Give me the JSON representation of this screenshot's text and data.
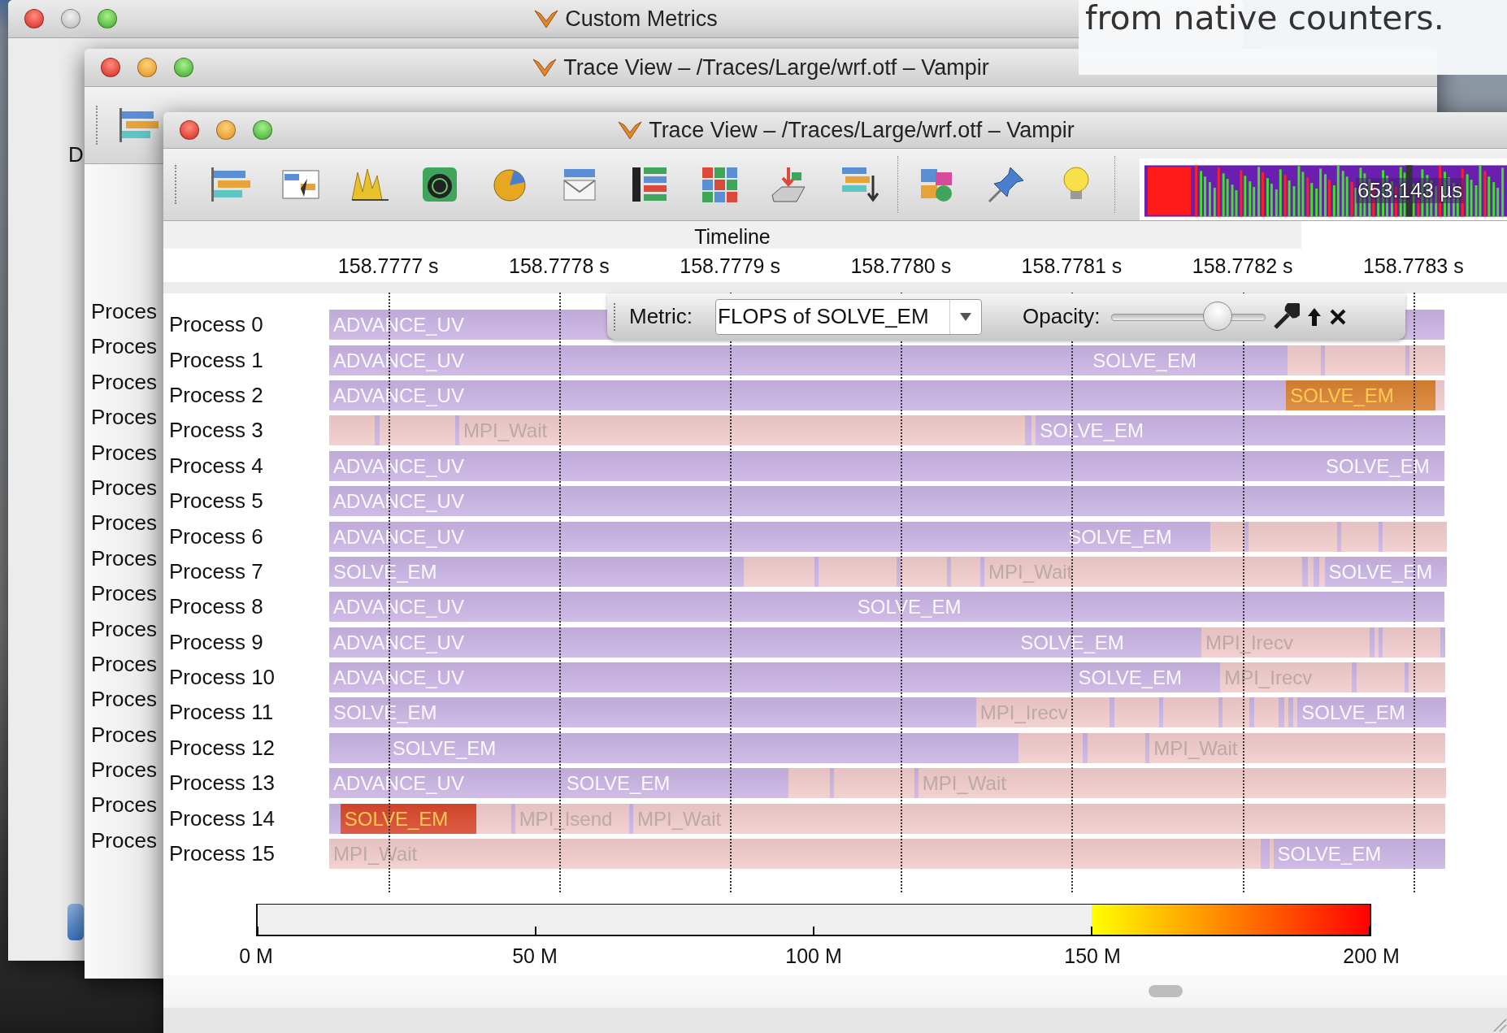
{
  "back_window": {
    "title": "Custom Metrics",
    "minimize_enabled": false,
    "side_text": "D"
  },
  "caption": {
    "text": "from native counters."
  },
  "middle_window": {
    "title": "Trace View – /Traces/Large/wrf.otf – Vampir",
    "minimize_enabled": true,
    "process_list": [
      "Proces",
      "Proces",
      "Proces",
      "Proces",
      "Proces",
      "Proces",
      "Proces",
      "Proces",
      "Proces",
      "Proces",
      "Proces",
      "Proces",
      "Proces",
      "Proces",
      "Proces",
      "Proces"
    ]
  },
  "trace_window": {
    "title": "Trace View – /Traces/Large/wrf.otf – Vampir",
    "minimize_enabled": true,
    "overview": {
      "reading": "653.143 µs"
    },
    "panel_title": "Timeline",
    "time_ticks": [
      "158.7777 s",
      "158.7778 s",
      "158.7779 s",
      "158.7780 s",
      "158.7781 s",
      "158.7782 s",
      "158.7783 s"
    ],
    "metric_bar": {
      "label": "Metric:",
      "metric": {
        "value": "FLOPS of SOLVE_EM"
      },
      "opacity": {
        "label": "Opacity:",
        "level": 0.69
      }
    },
    "processes": [
      {
        "name": "Process 0",
        "segments": [
          {
            "label": "ADVANCE_UV",
            "kind": "compute",
            "color": "#c9b3e3"
          }
        ]
      },
      {
        "name": "Process 1",
        "segments": [
          {
            "label": "ADVANCE_UV",
            "kind": "compute",
            "color": "#c9b3e3"
          },
          {
            "label": "SOLVE_EM",
            "kind": "compute",
            "color": "#c9b3e3"
          },
          {
            "kind": "mpi",
            "color": "#f1cbcb"
          },
          {
            "kind": "compute",
            "color": "#c9b3e3"
          },
          {
            "kind": "mpi",
            "color": "#f1cbcb"
          },
          {
            "kind": "compute",
            "color": "#c9b3e3"
          },
          {
            "kind": "mpi",
            "color": "#f1cbcb"
          }
        ]
      },
      {
        "name": "Process 2",
        "segments": [
          {
            "label": "ADVANCE_UV",
            "kind": "compute",
            "color": "#c9b3e3"
          },
          {
            "label": "SOLVE_EM",
            "kind": "hot",
            "color": "#d98130"
          },
          {
            "kind": "mpi",
            "color": "#f1cbcb"
          }
        ]
      },
      {
        "name": "Process 3",
        "segments": [
          {
            "kind": "mpi",
            "color": "#f1cbcb"
          },
          {
            "kind": "compute",
            "color": "#c9b3e3"
          },
          {
            "kind": "mpi",
            "color": "#f1cbcb"
          },
          {
            "kind": "compute",
            "color": "#c9b3e3"
          },
          {
            "label": "MPI_Wait",
            "kind": "mpi",
            "color": "#f1cbcb"
          },
          {
            "kind": "compute",
            "color": "#c9b3e3"
          },
          {
            "kind": "mpi",
            "color": "#f1cbcb"
          },
          {
            "label": "SOLVE_EM",
            "kind": "compute",
            "color": "#c9b3e3"
          }
        ]
      },
      {
        "name": "Process 4",
        "segments": [
          {
            "label": "ADVANCE_UV",
            "kind": "compute",
            "color": "#c9b3e3"
          },
          {
            "label": "SOLVE_EM",
            "kind": "compute",
            "color": "#c9b3e3"
          }
        ]
      },
      {
        "name": "Process 5",
        "segments": [
          {
            "label": "ADVANCE_UV",
            "kind": "compute",
            "color": "#c9b3e3"
          }
        ]
      },
      {
        "name": "Process 6",
        "segments": [
          {
            "label": "ADVANCE_UV",
            "kind": "compute",
            "color": "#c9b3e3"
          },
          {
            "label": "SOLVE_EM",
            "kind": "compute",
            "color": "#c9b3e3"
          },
          {
            "kind": "mpi",
            "color": "#f1cbcb"
          },
          {
            "kind": "compute",
            "color": "#c9b3e3"
          },
          {
            "kind": "mpi",
            "color": "#f1cbcb"
          },
          {
            "kind": "compute",
            "color": "#c9b3e3"
          },
          {
            "kind": "mpi",
            "color": "#f1cbcb"
          },
          {
            "kind": "compute",
            "color": "#c9b3e3"
          },
          {
            "kind": "mpi",
            "color": "#f1cbcb"
          }
        ]
      },
      {
        "name": "Process 7",
        "segments": [
          {
            "label": "SOLVE_EM",
            "kind": "compute",
            "color": "#c9b3e3"
          },
          {
            "kind": "mpi",
            "color": "#f1cbcb"
          },
          {
            "kind": "compute",
            "color": "#c9b3e3"
          },
          {
            "kind": "mpi",
            "color": "#f1cbcb"
          },
          {
            "kind": "compute",
            "color": "#c9b3e3"
          },
          {
            "kind": "mpi",
            "color": "#f1cbcb"
          },
          {
            "kind": "compute",
            "color": "#c9b3e3"
          },
          {
            "kind": "mpi",
            "color": "#f1cbcb"
          },
          {
            "kind": "compute",
            "color": "#c9b3e3"
          },
          {
            "label": "MPI_Wait",
            "kind": "mpi",
            "color": "#f1cbcb"
          },
          {
            "kind": "compute",
            "color": "#c9b3e3"
          },
          {
            "kind": "mpi",
            "color": "#f1cbcb"
          },
          {
            "kind": "compute",
            "color": "#c9b3e3"
          },
          {
            "kind": "mpi",
            "color": "#f1cbcb"
          },
          {
            "label": "SOLVE_EM",
            "kind": "compute",
            "color": "#c9b3e3"
          }
        ]
      },
      {
        "name": "Process 8",
        "segments": [
          {
            "label": "ADVANCE_UV",
            "kind": "compute",
            "color": "#c9b3e3"
          },
          {
            "label": "SOLVE_EM",
            "kind": "compute",
            "color": "#c9b3e3"
          }
        ]
      },
      {
        "name": "Process 9",
        "segments": [
          {
            "label": "ADVANCE_UV",
            "kind": "compute",
            "color": "#c9b3e3"
          },
          {
            "label": "SOLVE_EM",
            "kind": "compute",
            "color": "#c9b3e3"
          },
          {
            "label": "MPI_Irecv",
            "kind": "mpi",
            "color": "#f1cbcb"
          },
          {
            "kind": "compute",
            "color": "#c9b3e3"
          },
          {
            "kind": "mpi",
            "color": "#f1cbcb"
          },
          {
            "kind": "compute",
            "color": "#c9b3e3"
          },
          {
            "kind": "mpi",
            "color": "#f1cbcb"
          },
          {
            "kind": "compute",
            "color": "#c9b3e3"
          }
        ]
      },
      {
        "name": "Process 10",
        "segments": [
          {
            "label": "ADVANCE_UV",
            "kind": "compute",
            "color": "#c9b3e3"
          },
          {
            "label": "SOLVE_EM",
            "kind": "compute",
            "color": "#c9b3e3"
          },
          {
            "label": "MPI_Irecv",
            "kind": "mpi",
            "color": "#f1cbcb"
          },
          {
            "kind": "compute",
            "color": "#c9b3e3"
          },
          {
            "kind": "mpi",
            "color": "#f1cbcb"
          },
          {
            "kind": "compute",
            "color": "#c9b3e3"
          },
          {
            "kind": "mpi",
            "color": "#f1cbcb"
          }
        ]
      },
      {
        "name": "Process 11",
        "segments": [
          {
            "label": "SOLVE_EM",
            "kind": "compute",
            "color": "#c9b3e3"
          },
          {
            "label": "MPI_Irecv",
            "kind": "mpi",
            "color": "#f1cbcb"
          },
          {
            "kind": "compute",
            "color": "#c9b3e3"
          },
          {
            "kind": "mpi",
            "color": "#f1cbcb"
          },
          {
            "kind": "compute",
            "color": "#c9b3e3"
          },
          {
            "kind": "mpi",
            "color": "#f1cbcb"
          },
          {
            "kind": "compute",
            "color": "#c9b3e3"
          },
          {
            "kind": "mpi",
            "color": "#f1cbcb"
          },
          {
            "kind": "compute",
            "color": "#c9b3e3"
          },
          {
            "kind": "mpi",
            "color": "#f1cbcb"
          },
          {
            "kind": "compute",
            "color": "#c9b3e3"
          },
          {
            "kind": "mpi",
            "color": "#f1cbcb"
          },
          {
            "kind": "compute",
            "color": "#c9b3e3"
          },
          {
            "kind": "mpi",
            "color": "#f1cbcb"
          },
          {
            "label": "SOLVE_EM",
            "kind": "compute",
            "color": "#c9b3e3"
          }
        ]
      },
      {
        "name": "Process 12",
        "segments": [
          {
            "kind": "compute",
            "color": "#c9b3e3"
          },
          {
            "label": "SOLVE_EM",
            "kind": "compute",
            "color": "#c9b3e3"
          },
          {
            "kind": "mpi",
            "color": "#f1cbcb"
          },
          {
            "kind": "compute",
            "color": "#c9b3e3"
          },
          {
            "kind": "mpi",
            "color": "#f1cbcb"
          },
          {
            "kind": "compute",
            "color": "#c9b3e3"
          },
          {
            "label": "MPI_Wait",
            "kind": "mpi",
            "color": "#f1cbcb"
          }
        ]
      },
      {
        "name": "Process 13",
        "segments": [
          {
            "label": "ADVANCE_UV",
            "kind": "compute",
            "color": "#c9b3e3"
          },
          {
            "label": "SOLVE_EM",
            "kind": "compute",
            "color": "#c9b3e3"
          },
          {
            "kind": "mpi",
            "color": "#f1cbcb"
          },
          {
            "kind": "compute",
            "color": "#c9b3e3"
          },
          {
            "kind": "mpi",
            "color": "#f1cbcb"
          },
          {
            "kind": "compute",
            "color": "#c9b3e3"
          },
          {
            "label": "MPI_Wait",
            "kind": "mpi",
            "color": "#f1cbcb"
          }
        ]
      },
      {
        "name": "Process 14",
        "segments": [
          {
            "kind": "compute",
            "color": "#c9b3e3"
          },
          {
            "label": "SOLVE_EM",
            "kind": "hot",
            "color": "#d9472b"
          },
          {
            "kind": "mpi",
            "color": "#f1cbcb"
          },
          {
            "kind": "compute",
            "color": "#c9b3e3"
          },
          {
            "label": "MPI_Isend",
            "kind": "mpi",
            "color": "#f1cbcb"
          },
          {
            "kind": "compute",
            "color": "#c9b3e3"
          },
          {
            "label": "MPI_Wait",
            "kind": "mpi",
            "color": "#f1cbcb"
          }
        ]
      },
      {
        "name": "Process 15",
        "segments": [
          {
            "label": "MPI_Wait",
            "kind": "mpi",
            "color": "#f1cbcb"
          },
          {
            "kind": "compute",
            "color": "#c9b3e3"
          },
          {
            "kind": "mpi",
            "color": "#f1cbcb"
          },
          {
            "label": "SOLVE_EM",
            "kind": "compute",
            "color": "#c9b3e3"
          }
        ]
      }
    ],
    "legend": {
      "ticks": [
        "0 M",
        "50 M",
        "100 M",
        "150 M",
        "200 M"
      ]
    }
  }
}
